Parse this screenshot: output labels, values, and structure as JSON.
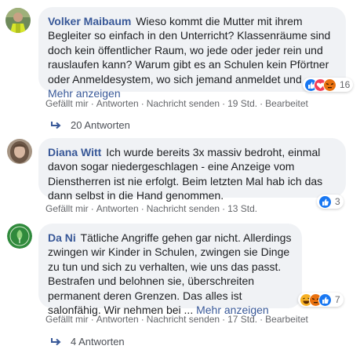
{
  "comments": [
    {
      "author": "Volker Maibaum",
      "text": "Wieso kommt die Mutter mit ihrem Begleiter so einfach in den Unterricht? Klassenräume sind doch kein öffentlicher Raum, wo jede oder jeder rein und rauslaufen kann? Warum gibt es an Schulen kein Pförtner oder Anmeldesystem, wo sich jemand anmeldet und ...",
      "more": "Mehr anzeigen",
      "reactions": [
        "like",
        "love",
        "angry"
      ],
      "reaction_count": "16",
      "actions": {
        "like": "Gefällt mir",
        "reply": "Antworten",
        "message": "Nachricht senden",
        "time": "19 Std.",
        "edited": "Bearbeitet"
      },
      "replies": "20 Antworten"
    },
    {
      "author": "Diana Witt",
      "text": "Ich wurde bereits 3x massiv bedroht, einmal davon sogar niedergeschlagen - eine Anzeige vom Dienstherren ist nie erfolgt. Beim letzten Mal hab ich das dann selbst in die Hand genommen.",
      "reactions": [
        "like"
      ],
      "reaction_count": "3",
      "actions": {
        "like": "Gefällt mir",
        "reply": "Antworten",
        "message": "Nachricht senden",
        "time": "13 Std."
      }
    },
    {
      "author": "Da Ni",
      "text": "Tätliche Angriffe gehen gar nicht. Allerdings zwingen wir Kinder in Schulen, zwingen sie Dinge zu tun und sich zu verhalten, wie uns das passt. Bestrafen und belohnen sie, überschreiten permanent deren Grenzen. Das alles ist salonfähig. Wir nehmen bei ...",
      "more": "Mehr anzeigen",
      "reactions": [
        "haha",
        "angry",
        "like"
      ],
      "reaction_count": "7",
      "actions": {
        "like": "Gefällt mir",
        "reply": "Antworten",
        "message": "Nachricht senden",
        "time": "17 Std.",
        "edited": "Bearbeitet"
      },
      "replies": "4 Antworten"
    }
  ],
  "colors": {
    "link": "#385898",
    "bubble": "#f0f2f5",
    "like": "#1877f2",
    "love": "#f33e58",
    "angry": "#e9710f",
    "haha": "#f7b125"
  }
}
